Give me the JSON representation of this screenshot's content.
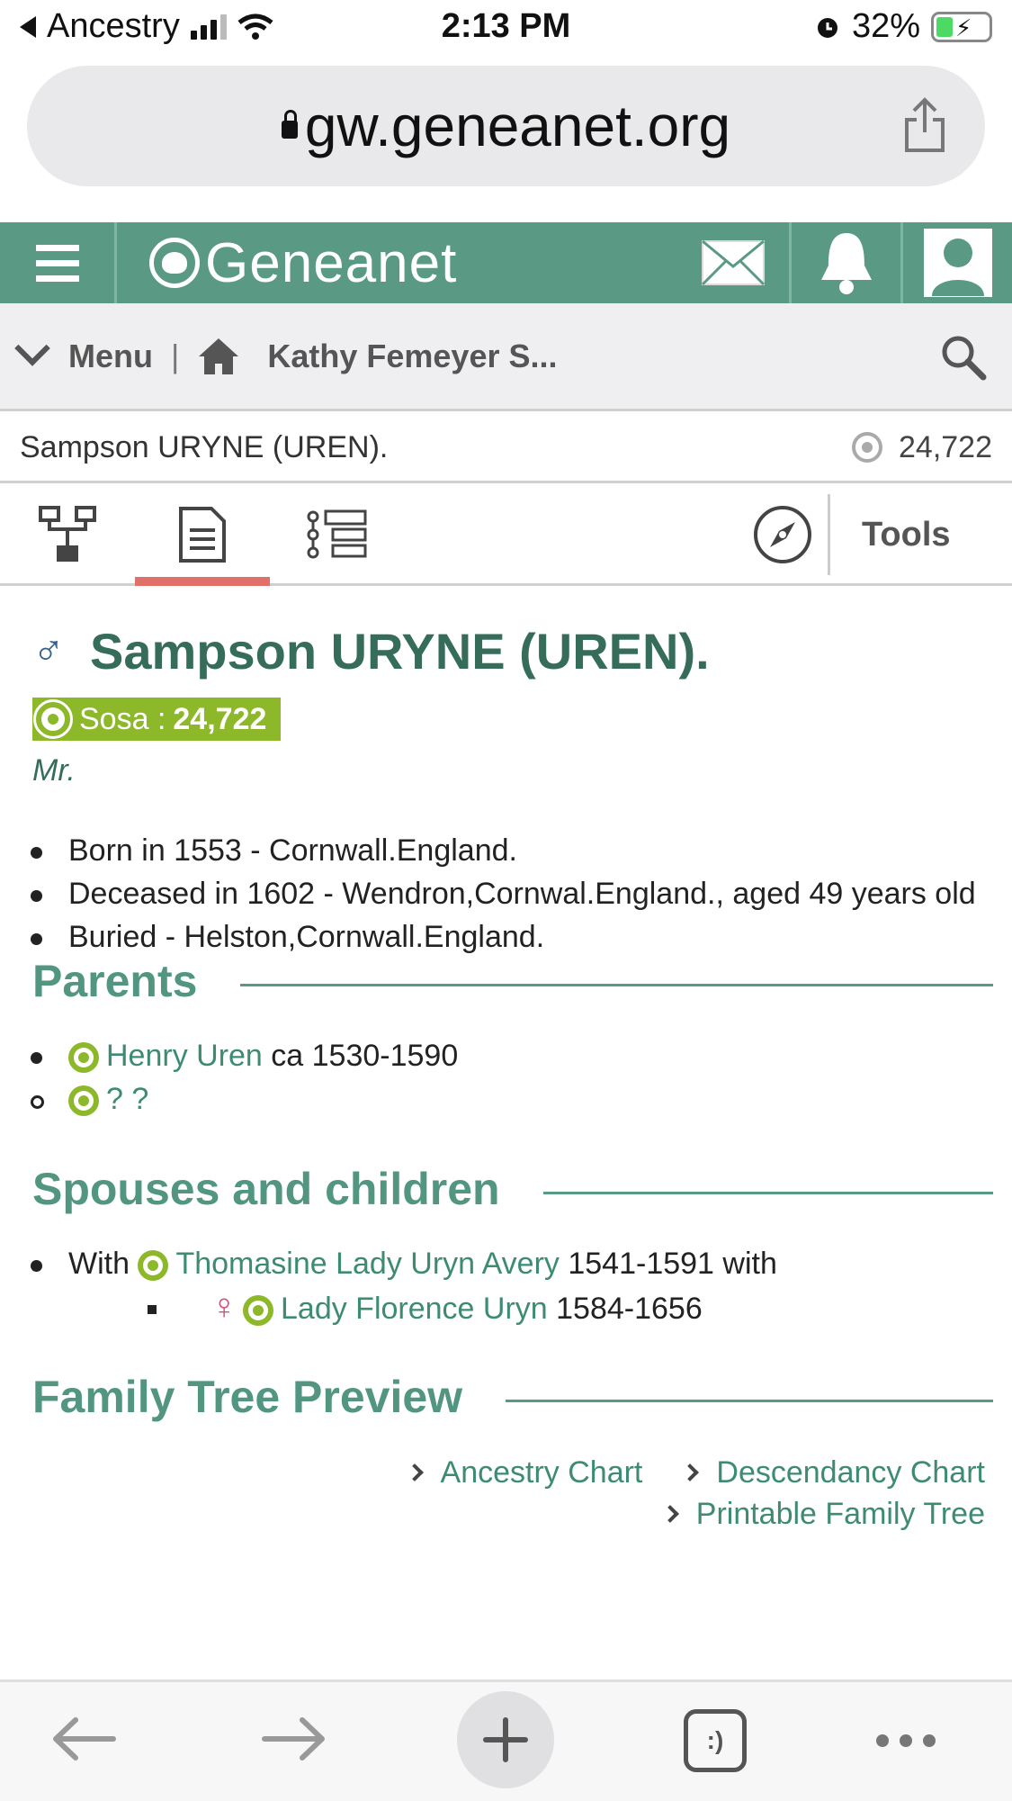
{
  "status_bar": {
    "back_app": "Ancestry",
    "time": "2:13 PM",
    "battery": "32%"
  },
  "url_bar": {
    "domain": "gw.geneanet.org"
  },
  "header": {
    "logo_text": "Geneanet",
    "icons": [
      "menu-icon",
      "mail-icon",
      "bell-icon",
      "user-icon"
    ]
  },
  "menu_bar": {
    "menu_label": "Menu",
    "separator": "|",
    "breadcrumb": "Kathy Femeyer S..."
  },
  "person_bar": {
    "name": "Sampson URYNE (UREN).",
    "sosa_number": "24,722"
  },
  "tabs": {
    "tools_label": "Tools",
    "items": [
      "tree-icon",
      "document-icon",
      "list-icon",
      "compass-icon"
    ],
    "active_index": 1
  },
  "person": {
    "name": "Sampson URYNE (UREN).",
    "gender_symbol": "♂",
    "sosa_label": "Sosa :",
    "sosa_value": "24,722",
    "title": "Mr.",
    "facts": [
      "Born in 1553 - Cornwall.England.",
      "Deceased in 1602 - Wendron,Cornwal.England., aged 49 years old",
      "Buried - Helston,Cornwall.England."
    ]
  },
  "parents": {
    "heading": "Parents",
    "father_name": "Henry Uren",
    "father_dates": " ca 1530-1590",
    "mother_name": "? ?"
  },
  "spouses": {
    "heading": "Spouses and children",
    "with_label": "With ",
    "spouse_name": "Thomasine Lady Uryn Avery",
    "spouse_dates": " 1541-1591 with",
    "child_symbol": "♀",
    "child_name": "Lady Florence Uryn",
    "child_dates": " 1584-1656"
  },
  "tree_preview": {
    "heading": "Family Tree Preview",
    "links": [
      "Ancestry Chart",
      "Descendancy Chart",
      "Printable Family Tree"
    ]
  },
  "bottom_bar": {
    "tabs_label": ":)"
  },
  "colors": {
    "brand_green": "#5a9a85",
    "heading_green": "#356c5a",
    "sosa_green": "#8cb82a",
    "active_tab": "#e07068",
    "female_pink": "#d0507f",
    "male_blue": "#34618c"
  }
}
